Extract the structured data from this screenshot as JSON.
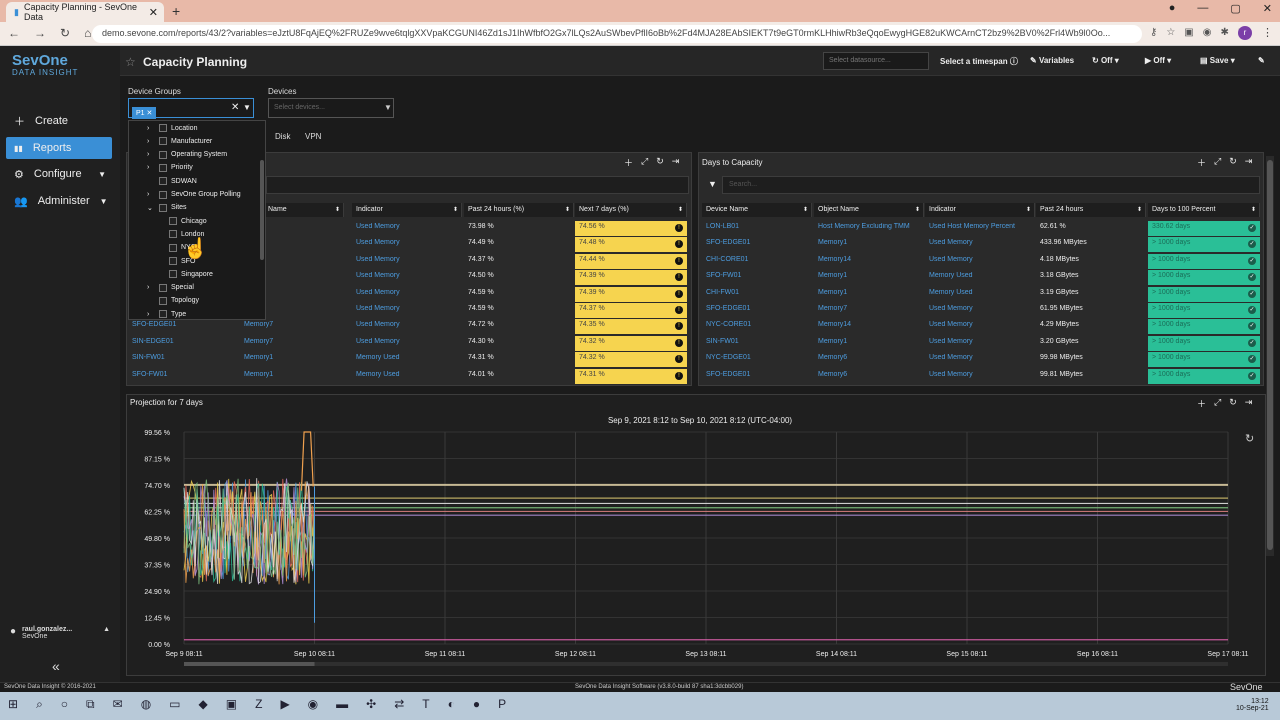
{
  "browser": {
    "tab_title": "Capacity Planning - SevOne Data",
    "new_tab": "+",
    "url": "demo.sevone.com/reports/43/2?variables=eJztU8FqAjEQ%2FRUZe9wve6tqlgXXVpaKCGUNI46Zd1sJ1IhWfbfO2Gx7lLQs2AuSWbevPflI6oBb%2Fd4MJA28EAbSIEKT7t9eGT0rmKLHhiwRb3eQqoEwygHGE82uKWCArnCT2bz9%2BV0%2Frl4Wb9l0Oo...",
    "profile_initial": "r"
  },
  "sidebar": {
    "logo_line1": "SevOne",
    "logo_line2": "DATA INSIGHT",
    "items": [
      {
        "label": "Create",
        "icon": "plus-icon"
      },
      {
        "label": "Reports",
        "icon": "bar-chart-icon"
      },
      {
        "label": "Configure",
        "icon": "gear-icon"
      },
      {
        "label": "Administer",
        "icon": "users-icon"
      }
    ],
    "user_name": "raul.gonzalez...",
    "user_org": "SevOne"
  },
  "header": {
    "title": "Capacity Planning",
    "datasource_placeholder": "Select datasource...",
    "timespan": "Select a timespan",
    "variables": "Variables",
    "refresh": "Off",
    "autoplay": "Off",
    "save": "Save"
  },
  "filters": {
    "device_groups_label": "Device Groups",
    "device_groups_chip": "P1",
    "devices_label": "Devices",
    "devices_placeholder": "Select devices..."
  },
  "tabs": [
    "Disk",
    "VPN"
  ],
  "tree": [
    {
      "label": "Location",
      "arrow": "›",
      "level": 0
    },
    {
      "label": "Manufacturer",
      "arrow": "›",
      "level": 0
    },
    {
      "label": "Operating System",
      "arrow": "›",
      "level": 0
    },
    {
      "label": "Priority",
      "arrow": "›",
      "level": 0
    },
    {
      "label": "SDWAN",
      "arrow": "",
      "level": 0
    },
    {
      "label": "SevOne Group Polling",
      "arrow": "›",
      "level": 0
    },
    {
      "label": "Sites",
      "arrow": "⌄",
      "level": 0
    },
    {
      "label": "Chicago",
      "arrow": "",
      "level": 1
    },
    {
      "label": "London",
      "arrow": "",
      "level": 1
    },
    {
      "label": "NYC",
      "arrow": "",
      "level": 1
    },
    {
      "label": "SFO",
      "arrow": "",
      "level": 1
    },
    {
      "label": "Singapore",
      "arrow": "",
      "level": 1
    },
    {
      "label": "Special",
      "arrow": "›",
      "level": 0
    },
    {
      "label": "Topology",
      "arrow": "",
      "level": 0
    },
    {
      "label": "Type",
      "arrow": "›",
      "level": 0
    }
  ],
  "left_table": {
    "headers": [
      "Name",
      "Indicator",
      "Past 24 hours (%)",
      "Next 7 days (%)"
    ],
    "rows": [
      [
        "",
        "ry7",
        "Used Memory",
        "73.98 %",
        "74.56 %"
      ],
      [
        "",
        "ry8",
        "Used Memory",
        "74.49 %",
        "74.48 %"
      ],
      [
        "",
        "ry8",
        "Used Memory",
        "74.37 %",
        "74.44 %"
      ],
      [
        "",
        "ry8",
        "Used Memory",
        "74.50 %",
        "74.39 %"
      ],
      [
        "",
        "ry6",
        "Used Memory",
        "74.59 %",
        "74.39 %"
      ],
      [
        "",
        "ry7",
        "Used Memory",
        "74.59 %",
        "74.37 %"
      ],
      [
        "SFO-EDGE01",
        "Memory7",
        "Used Memory",
        "74.72 %",
        "74.35 %"
      ],
      [
        "SIN-EDGE01",
        "Memory7",
        "Used Memory",
        "74.30 %",
        "74.32 %"
      ],
      [
        "SIN-FW01",
        "Memory1",
        "Memory Used",
        "74.31 %",
        "74.32 %"
      ],
      [
        "SFO-FW01",
        "Memory1",
        "Memory Used",
        "74.01 %",
        "74.31 %"
      ]
    ]
  },
  "right_table": {
    "title": "Days to Capacity",
    "search_placeholder": "Search...",
    "headers": [
      "Device Name",
      "Object Name",
      "Indicator",
      "Past 24 hours",
      "Days to 100 Percent"
    ],
    "rows": [
      [
        "LON-LB01",
        "Host Memory Excluding TMM",
        "Used Host Memory Percent",
        "62.61 %",
        "330.62 days"
      ],
      [
        "SFO-EDGE01",
        "Memory1",
        "Used Memory",
        "433.96 MBytes",
        "> 1000 days"
      ],
      [
        "CHI-CORE01",
        "Memory14",
        "Used Memory",
        "4.18 MBytes",
        "> 1000 days"
      ],
      [
        "SFO-FW01",
        "Memory1",
        "Memory Used",
        "3.18 GBytes",
        "> 1000 days"
      ],
      [
        "CHI-FW01",
        "Memory1",
        "Memory Used",
        "3.19 GBytes",
        "> 1000 days"
      ],
      [
        "SFO-EDGE01",
        "Memory7",
        "Used Memory",
        "61.95 MBytes",
        "> 1000 days"
      ],
      [
        "NYC-CORE01",
        "Memory14",
        "Used Memory",
        "4.29 MBytes",
        "> 1000 days"
      ],
      [
        "SIN-FW01",
        "Memory1",
        "Used Memory",
        "3.20 GBytes",
        "> 1000 days"
      ],
      [
        "NYC-EDGE01",
        "Memory6",
        "Used Memory",
        "99.98 MBytes",
        "> 1000 days"
      ],
      [
        "SFO-EDGE01",
        "Memory6",
        "Used Memory",
        "99.81 MBytes",
        "> 1000 days"
      ]
    ]
  },
  "chart_data": {
    "type": "line",
    "title": "Projection for 7 days",
    "subtitle": "Sep 9, 2021 8:12 to Sep 10, 2021 8:12 (UTC-04:00)",
    "y_ticks": [
      "0.00 %",
      "12.45 %",
      "24.90 %",
      "37.35 %",
      "49.80 %",
      "62.25 %",
      "74.70 %",
      "87.15 %",
      "99.56 %"
    ],
    "ylim": [
      0,
      99.56
    ],
    "x_ticks": [
      "Sep 9 08:11",
      "Sep 10 08:11",
      "Sep 11 08:11",
      "Sep 12 08:11",
      "Sep 13 08:11",
      "Sep 14 08:11",
      "Sep 15 08:11",
      "Sep 16 08:11",
      "Sep 17 08:11"
    ],
    "xlim": [
      0,
      8
    ],
    "projection_levels": [
      74.7,
      68.5,
      66.0,
      64.0,
      62.25,
      60.5,
      2.0
    ],
    "projection_colors": [
      "#d8c9a0",
      "#c9b96a",
      "#e0e0e0",
      "#7ec07e",
      "#d47b7b",
      "#b28fd8",
      "#d65fa8"
    ],
    "history_colors": [
      "#4d9de0",
      "#f6d44f",
      "#e86c5a",
      "#2abf97",
      "#b28fd8",
      "#f0a14f",
      "#e0e0e0",
      "#7ec07e"
    ],
    "history_range_pct": [
      28,
      78
    ],
    "spike_peak_pct": 99.56
  },
  "footer": {
    "copyright": "SevOne Data Insight © 2016-2021",
    "build": "SevOne Data Insight Software (v3.8.0-build 87 sha1:3dcbb029)",
    "brand": "SevOne"
  },
  "taskbar": {
    "time": "13:12",
    "date": "10-Sep-21"
  }
}
